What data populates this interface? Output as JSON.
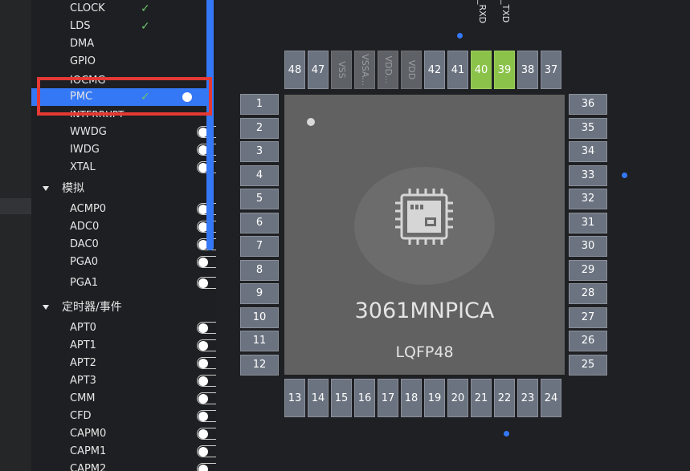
{
  "sidebar": {
    "items_top": [
      {
        "label": "CLOCK",
        "checked": true
      },
      {
        "label": "LDS",
        "checked": true
      },
      {
        "label": "DMA"
      },
      {
        "label": "GPIO"
      },
      {
        "label": "IOCMG"
      }
    ],
    "selected": {
      "label": "PMC",
      "checked": true,
      "toggle": "on"
    },
    "partial_label": "INTERRUPT",
    "items_mid": [
      "WWDG",
      "IWDG",
      "XTAL"
    ],
    "cat_analog": "模拟",
    "items_analog": [
      "ACMP0",
      "ADC0",
      "DAC0",
      "PGA0",
      "PGA1"
    ],
    "cat_timer": "定时器/事件",
    "items_timer": [
      "APT0",
      "APT1",
      "APT2",
      "APT3",
      "CMM",
      "CFD",
      "CAPM0",
      "CAPM1",
      "CAPM2"
    ]
  },
  "chip": {
    "part_number": "3061MNPICA",
    "package": "LQFP48",
    "top_signal_labels": [
      "_RXD",
      "_TXD"
    ],
    "pins_left": [
      "1",
      "2",
      "3",
      "4",
      "5",
      "6",
      "7",
      "8",
      "9",
      "10",
      "11",
      "12"
    ],
    "pins_bottom": [
      "13",
      "14",
      "15",
      "16",
      "17",
      "18",
      "19",
      "20",
      "21",
      "22",
      "23",
      "24"
    ],
    "pins_right": [
      "36",
      "35",
      "34",
      "33",
      "32",
      "31",
      "30",
      "29",
      "28",
      "27",
      "26",
      "25"
    ],
    "pins_top": [
      {
        "label": "48",
        "state": "normal"
      },
      {
        "label": "47",
        "state": "normal"
      },
      {
        "label": "VSS",
        "state": "power"
      },
      {
        "label": "VSSA...",
        "state": "power"
      },
      {
        "label": "VDD...",
        "state": "power"
      },
      {
        "label": "VDD",
        "state": "power"
      },
      {
        "label": "42",
        "state": "normal"
      },
      {
        "label": "41",
        "state": "normal"
      },
      {
        "label": "40",
        "state": "assigned"
      },
      {
        "label": "39",
        "state": "assigned"
      },
      {
        "label": "38",
        "state": "normal"
      },
      {
        "label": "37",
        "state": "normal"
      }
    ],
    "colors": {
      "assigned": "#8bc34a",
      "normal": "#6b7380",
      "power": "#5e6166",
      "accent": "#3478f6",
      "highlight": "#e53935"
    }
  }
}
